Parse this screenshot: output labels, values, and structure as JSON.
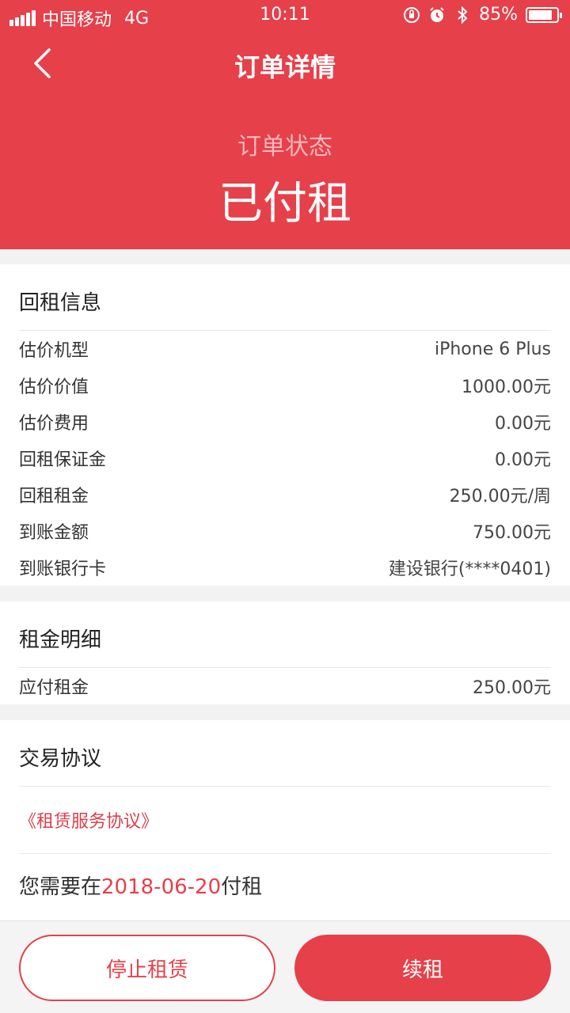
{
  "statusbar": {
    "carrier": "中国移动",
    "network": "4G",
    "time": "10:11",
    "battery": "85%",
    "battery_level": 0.85
  },
  "navbar": {
    "title": "订单详情"
  },
  "order_status": {
    "label": "订单状态",
    "value": "已付租"
  },
  "rental_info": {
    "title": "回租信息",
    "rows": [
      {
        "label": "估价机型",
        "value": "iPhone 6 Plus"
      },
      {
        "label": "估价价值",
        "value": "1000.00元"
      },
      {
        "label": "估价费用",
        "value": "0.00元"
      },
      {
        "label": "回租保证金",
        "value": "0.00元"
      },
      {
        "label": "回租租金",
        "value": "250.00元/周"
      },
      {
        "label": "到账金额",
        "value": "750.00元"
      },
      {
        "label": "到账银行卡",
        "value": "建设银行(****0401)"
      }
    ]
  },
  "rent_detail": {
    "title": "租金明细",
    "rows": [
      {
        "label": "应付租金",
        "value": "250.00元"
      }
    ]
  },
  "agreement": {
    "title": "交易协议",
    "link": "《租赁服务协议》",
    "pay_prefix": "您需要在",
    "pay_date": "2018-06-20",
    "pay_suffix": "付租"
  },
  "actions": {
    "stop_label": "停止租赁",
    "renew_label": "续租"
  },
  "colors": {
    "accent": "#e6404a",
    "background": "#f2f2f2"
  },
  "icons": [
    "signal-icon",
    "orientation-lock-icon",
    "alarm-icon",
    "bluetooth-icon",
    "battery-icon",
    "back-arrow-icon"
  ]
}
